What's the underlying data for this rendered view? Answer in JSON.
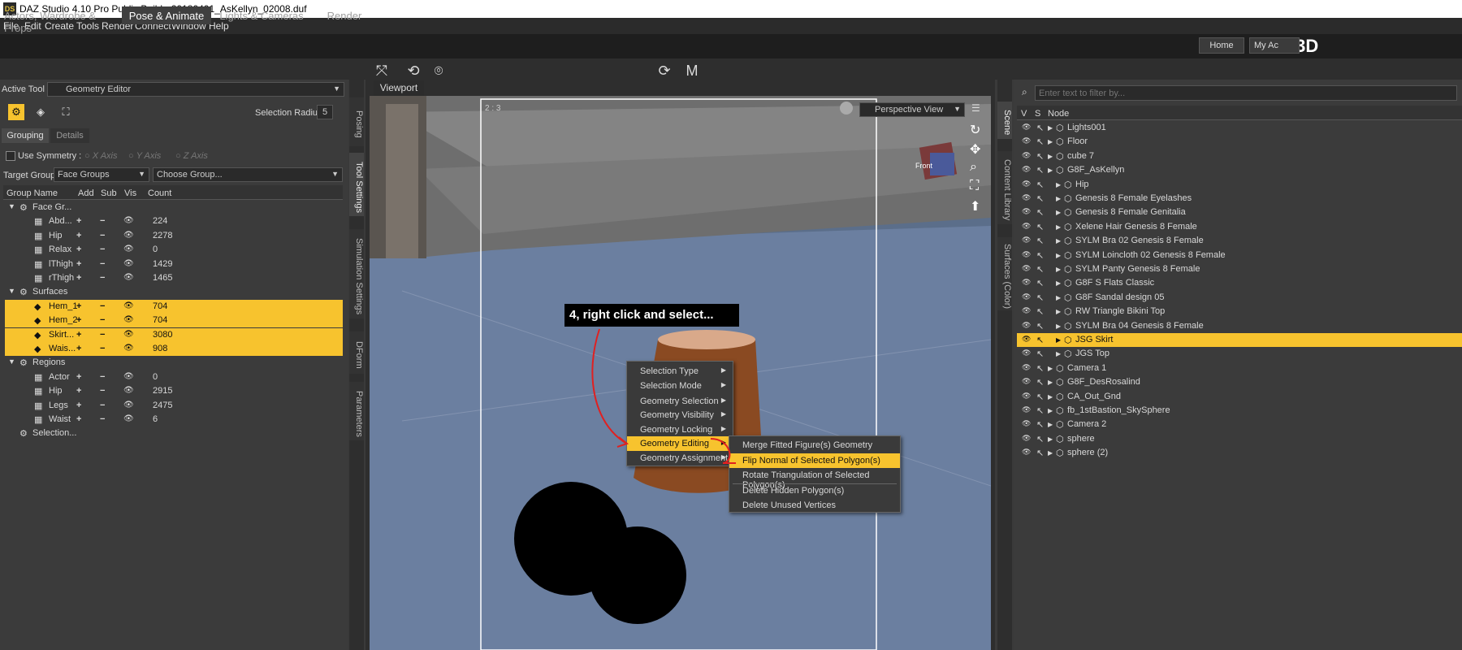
{
  "window": {
    "title": "DAZ Studio 4.10 Pro Public Build - 20180401_AsKellyn_02008.duf",
    "app_icon": "DS"
  },
  "menubar": [
    "File",
    "Edit",
    "Create",
    "Tools",
    "Render",
    "Connect",
    "Window",
    "Help"
  ],
  "main_tabs": [
    "Actors, Wardrobe & Props",
    "Pose & Animate",
    "Lights & Cameras",
    "Render"
  ],
  "brand": {
    "logo": "Daz3D",
    "home": "Home",
    "my_account": "My Ac"
  },
  "tool_options": {
    "active_tool_label": "Active Tool :",
    "active_tool_value": "Geometry Editor",
    "selection_radius_label": "Selection Radius :",
    "selection_radius_value": "5",
    "subtabs": [
      "Grouping",
      "Details"
    ],
    "use_symmetry": "Use Symmetry :",
    "axes": [
      "X Axis",
      "Y Axis",
      "Z Axis"
    ],
    "target_group_label": "Target Group :",
    "target_group_value": "Face Groups",
    "choose_group": "Choose Group...",
    "columns": [
      "Group Name",
      "Add",
      "Sub",
      "Vis",
      "Count"
    ],
    "groups": [
      {
        "name": "Face Gr...",
        "type": "category"
      },
      {
        "name": "Abd...",
        "add": "+",
        "sub": "−",
        "count": "224"
      },
      {
        "name": "Hip",
        "add": "+",
        "sub": "−",
        "count": "2278"
      },
      {
        "name": "Relax",
        "add": "+",
        "sub": "−",
        "count": "0"
      },
      {
        "name": "lThigh",
        "add": "+",
        "sub": "−",
        "count": "1429"
      },
      {
        "name": "rThigh",
        "add": "+",
        "sub": "−",
        "count": "1465"
      },
      {
        "name": "Surfaces",
        "type": "category"
      },
      {
        "name": "Hem_1",
        "add": "+",
        "sub": "−",
        "count": "704"
      },
      {
        "name": "Hem_2",
        "add": "+",
        "sub": "−",
        "count": "704"
      },
      {
        "name": "Skirt...",
        "add": "+",
        "sub": "−",
        "count": "3080"
      },
      {
        "name": "Wais...",
        "add": "+",
        "sub": "−",
        "count": "908"
      },
      {
        "name": "Regions",
        "type": "category"
      },
      {
        "name": "Actor",
        "add": "+",
        "sub": "−",
        "count": "0"
      },
      {
        "name": "Hip",
        "add": "+",
        "sub": "−",
        "count": "2915"
      },
      {
        "name": "Legs",
        "add": "+",
        "sub": "−",
        "count": "2475"
      },
      {
        "name": "Waist",
        "add": "+",
        "sub": "−",
        "count": "6"
      },
      {
        "name": "Selection...",
        "type": "category"
      }
    ]
  },
  "side_tabs_left": [
    "Posing",
    "Tool Settings",
    "Simulation Settings",
    "DForm",
    "Parameters"
  ],
  "viewport": {
    "tab": "Viewport",
    "view_mode": "Perspective View",
    "frame_label": "2 : 3",
    "cube_label": "Front"
  },
  "callout": "4, right click and select...",
  "context_menu": [
    "Selection Type",
    "Selection Mode",
    "Geometry Selection",
    "Geometry Visibility",
    "Geometry Locking",
    "Geometry Editing",
    "Geometry Assignment"
  ],
  "submenu": [
    "Merge Fitted Figure(s) Geometry",
    "Flip Normal of Selected Polygon(s)",
    "Rotate Triangulation of Selected Polygon(s)",
    "Delete Hidden Polygon(s)",
    "Delete Unused Vertices"
  ],
  "side_tabs_right": [
    "Scene",
    "Content Library",
    "Surfaces (Color)"
  ],
  "scene": {
    "filter_placeholder": "Enter text to filter by...",
    "columns": [
      "V",
      "S",
      "Node"
    ],
    "nodes": [
      "Lights001",
      "Floor",
      "cube 7",
      "G8F_AsKellyn",
      "Hip",
      "Genesis 8 Female Eyelashes",
      "Genesis 8 Female Genitalia",
      "Xelene Hair Genesis 8 Female",
      "SYLM Bra 02 Genesis 8 Female",
      "SYLM Loincloth 02 Genesis 8 Female",
      "SYLM Panty Genesis 8 Female",
      "G8F S Flats Classic",
      "G8F Sandal design 05",
      "RW Triangle Bikini Top",
      "SYLM Bra 04 Genesis 8 Female",
      "JSG Skirt",
      "JGS Top",
      "Camera 1",
      "G8F_DesRosalind",
      "CA_Out_Gnd",
      "fb_1stBastion_SkySphere",
      "Camera 2",
      "sphere",
      "sphere (2)"
    ]
  },
  "colors": {
    "accent": "#f7c32e",
    "panel": "#3b3b3b",
    "viewport": "#5a6f8c"
  }
}
